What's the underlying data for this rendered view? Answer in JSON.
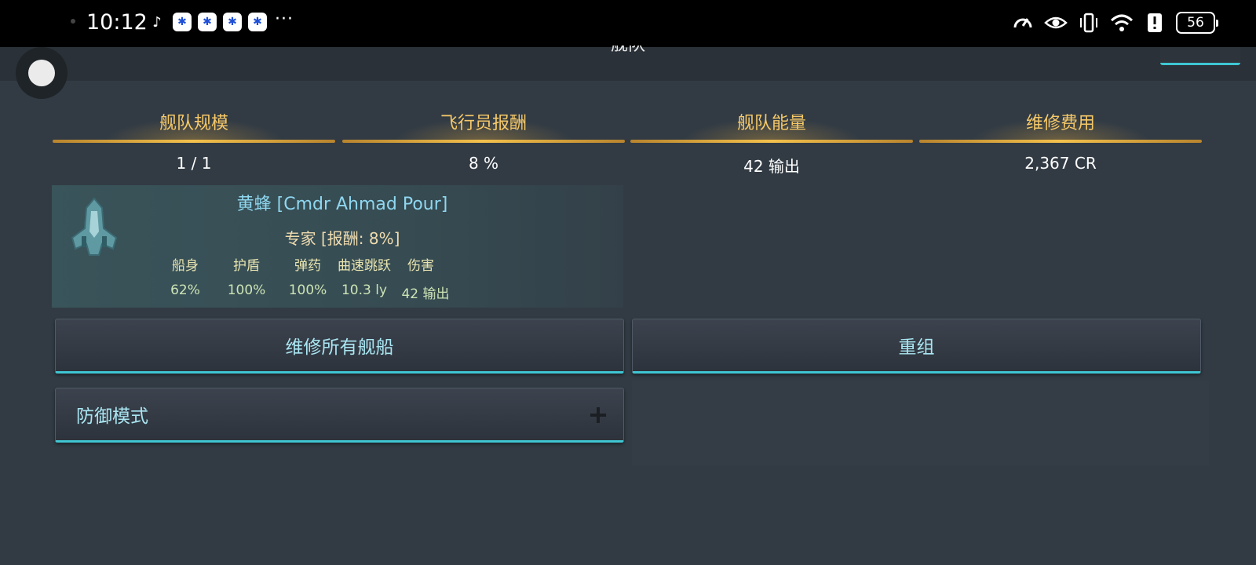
{
  "status_bar": {
    "time": "10:12",
    "more": "···",
    "battery": "56",
    "icons": [
      "tiktok-icon",
      "baidu-icon",
      "baidu-icon",
      "baidu-icon",
      "baidu-icon"
    ],
    "right_icons": [
      "speedometer-icon",
      "eye-icon",
      "vibrate-icon",
      "wifi-icon",
      "alert-icon",
      "battery-icon"
    ]
  },
  "header": {
    "title": "舰队"
  },
  "stats": [
    {
      "label": "舰队规模",
      "value": "1 / 1"
    },
    {
      "label": "飞行员报酬",
      "value": "8 %"
    },
    {
      "label": "舰队能量",
      "value": "42 输出"
    },
    {
      "label": "维修费用",
      "value": "2,367 CR"
    }
  ],
  "ship": {
    "name": "黄蜂 [Cmdr Ahmad Pour]",
    "role": "专家 [报酬: 8%]",
    "stat_labels": [
      "船身",
      "护盾",
      "弹药",
      "曲速跳跃",
      "伤害"
    ],
    "stat_values": [
      "62%",
      "100%",
      "100%",
      "10.3 ly",
      "42 输出"
    ]
  },
  "buttons": {
    "repair_all": "维修所有舰船",
    "reorganize": "重组",
    "defense_mode": "防御模式"
  },
  "colors": {
    "accent": "#3fc6d3",
    "gold": "#f5c868",
    "background": "#323b44"
  }
}
